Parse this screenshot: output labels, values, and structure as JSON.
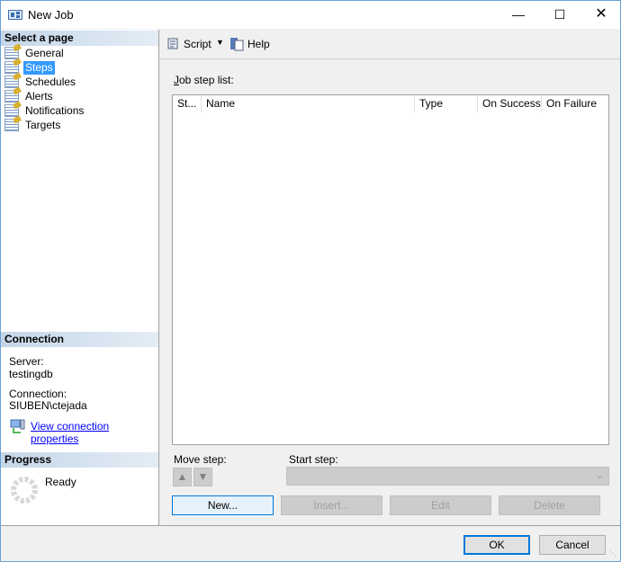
{
  "window": {
    "title": "New Job",
    "minimize_icon": "minimize-icon",
    "maximize_icon": "maximize-icon",
    "close_icon": "close-icon"
  },
  "sidebar": {
    "select_header": "Select a page",
    "items": [
      {
        "label": "General"
      },
      {
        "label": "Steps",
        "selected": true
      },
      {
        "label": "Schedules"
      },
      {
        "label": "Alerts"
      },
      {
        "label": "Notifications"
      },
      {
        "label": "Targets"
      }
    ],
    "connection_header": "Connection",
    "server_label": "Server:",
    "server_value": "testingdb",
    "connection_label": "Connection:",
    "connection_value": "SIUBEN\\ctejada",
    "view_link": "View connection properties",
    "progress_header": "Progress",
    "progress_status": "Ready"
  },
  "toolbar": {
    "script": "Script",
    "help": "Help"
  },
  "main": {
    "list_label": "Job step list:",
    "columns": [
      "St...",
      "Name",
      "Type",
      "On Success",
      "On Failure"
    ],
    "rows": [],
    "move_step_label": "Move step:",
    "start_step_label": "Start step:",
    "start_step_value": "",
    "buttons": {
      "new": "New...",
      "insert": "Insert...",
      "edit": "Edit",
      "delete": "Delete"
    }
  },
  "footer": {
    "ok": "OK",
    "cancel": "Cancel"
  },
  "colors": {
    "accent": "#0078d7",
    "selection": "#3399ff",
    "link": "#0000ff"
  }
}
